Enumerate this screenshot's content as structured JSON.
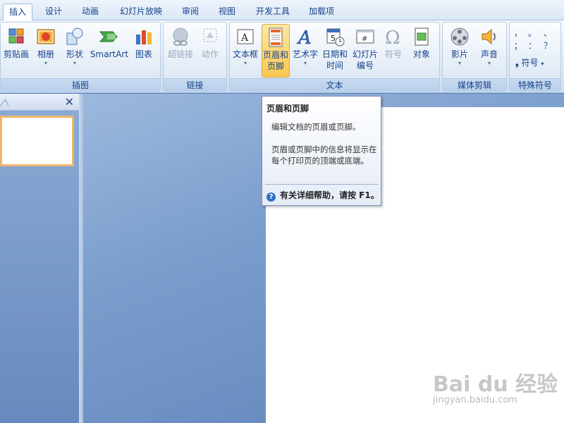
{
  "tabs": [
    {
      "label": "插入",
      "active": true
    },
    {
      "label": "设计"
    },
    {
      "label": "动画"
    },
    {
      "label": "幻灯片放映"
    },
    {
      "label": "审阅"
    },
    {
      "label": "视图"
    },
    {
      "label": "开发工具"
    },
    {
      "label": "加载项"
    }
  ],
  "groups": {
    "illustrations": {
      "label": "插图",
      "buttons": [
        {
          "label": "剪贴画",
          "icon": "clipart-icon"
        },
        {
          "label": "相册",
          "icon": "photo-album-icon"
        },
        {
          "label": "形状",
          "icon": "shapes-icon"
        },
        {
          "label": "SmartArt",
          "icon": "smartart-icon"
        },
        {
          "label": "图表",
          "icon": "chart-icon"
        }
      ]
    },
    "links": {
      "label": "链接",
      "buttons": [
        {
          "label": "超链接",
          "icon": "hyperlink-icon",
          "disabled": true
        },
        {
          "label": "动作",
          "icon": "action-icon",
          "disabled": true
        }
      ]
    },
    "text": {
      "label": "文本",
      "buttons": [
        {
          "label": "文本框",
          "icon": "textbox-icon"
        },
        {
          "label": "页眉和",
          "label2": "页脚",
          "icon": "header-footer-icon",
          "pressed": true
        },
        {
          "label": "艺术字",
          "icon": "wordart-icon"
        },
        {
          "label": "日期和",
          "label2": "时间",
          "icon": "date-time-icon"
        },
        {
          "label": "幻灯片",
          "label2": "编号",
          "icon": "slide-number-icon"
        },
        {
          "label": "符号",
          "icon": "symbol-icon",
          "disabled": true
        },
        {
          "label": "对象",
          "icon": "object-icon"
        }
      ]
    },
    "media": {
      "label": "媒体剪辑",
      "buttons": [
        {
          "label": "影片",
          "icon": "movie-icon"
        },
        {
          "label": "声音",
          "icon": "sound-icon"
        }
      ]
    },
    "special": {
      "label": "特殊符号",
      "symbols": [
        "，",
        "。",
        "、",
        "；",
        "：",
        "？"
      ],
      "symbol_button": "符号"
    }
  },
  "tooltip": {
    "title": "页眉和页脚",
    "desc": "编辑文档的页眉或页脚。",
    "desc2": "页眉或页脚中的信息将显示在每个打印页的顶端或底端。",
    "help": "有关详细帮助，请按 F1。"
  },
  "slide_pane": {
    "close": "✕"
  },
  "watermark": {
    "logo": "Bai du 经验",
    "url": "jingyan.baidu.com"
  },
  "colors": {
    "accent": "#15428b",
    "pressed": "#f9c84e",
    "ribbon": "#dfe9f5"
  }
}
